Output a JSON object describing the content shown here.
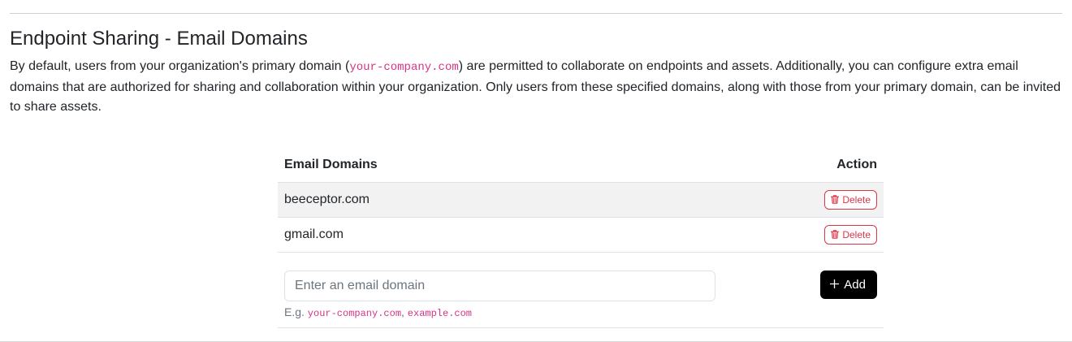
{
  "section": {
    "title": "Endpoint Sharing - Email Domains",
    "description": {
      "before": "By default, users from your organization's primary domain (",
      "code": "your-company.com",
      "after": ") are permitted to collaborate on endpoints and assets. Additionally, you can configure extra email domains that are authorized for sharing and collaboration within your organization. Only users from these specified domains, along with those from your primary domain, can be invited to share assets."
    }
  },
  "table": {
    "headers": {
      "domain": "Email Domains",
      "action": "Action"
    },
    "rows": [
      {
        "domain": "beeceptor.com",
        "delete_label": "Delete"
      },
      {
        "domain": "gmail.com",
        "delete_label": "Delete"
      }
    ]
  },
  "add_form": {
    "input_placeholder": "Enter an email domain",
    "input_value": "",
    "hint_prefix": "E.g. ",
    "hint_example_1": "your-company.com",
    "hint_separator": ", ",
    "hint_example_2": "example.com",
    "add_label": "Add"
  },
  "icons": {
    "delete": "trash-icon",
    "add": "plus-icon"
  },
  "colors": {
    "code_pink": "#d63384",
    "danger_red": "#dc3545",
    "add_button_bg": "#000000",
    "row_stripe": "#f2f2f2"
  }
}
